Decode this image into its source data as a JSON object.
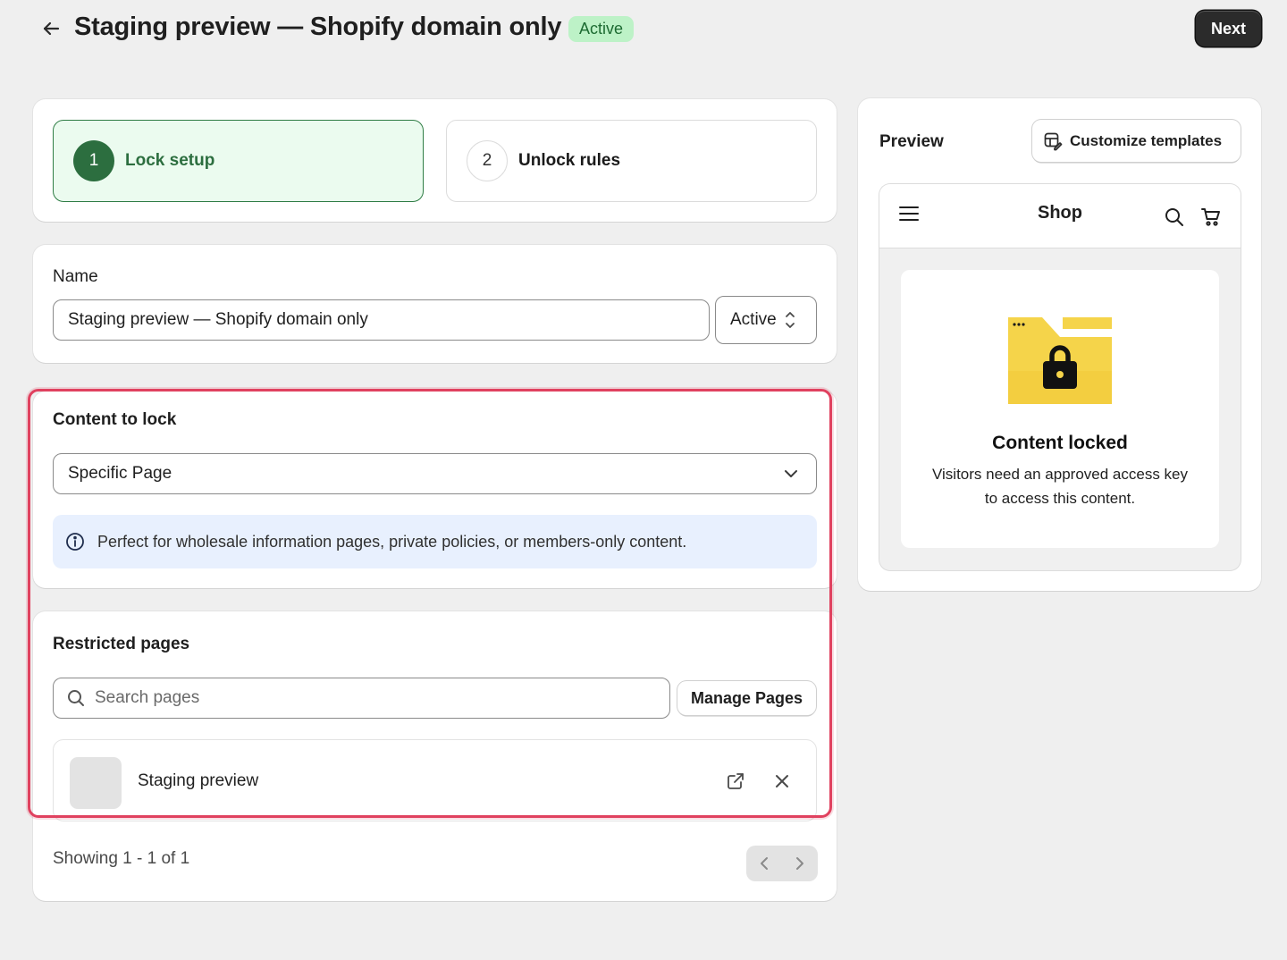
{
  "header": {
    "title": "Staging preview — Shopify domain only",
    "status_badge": "Active",
    "next_label": "Next"
  },
  "steps": [
    {
      "number": "1",
      "label": "Lock setup",
      "active": true
    },
    {
      "number": "2",
      "label": "Unlock rules",
      "active": false
    }
  ],
  "name_section": {
    "label": "Name",
    "value": "Staging preview — Shopify domain only",
    "status_select": "Active"
  },
  "content_to_lock": {
    "title": "Content to lock",
    "selected": "Specific Page",
    "info": "Perfect for wholesale information pages, private policies, or members-only content."
  },
  "restricted_pages": {
    "title": "Restricted pages",
    "search_placeholder": "Search pages",
    "manage_label": "Manage Pages",
    "pages": [
      {
        "title": "Staging preview"
      }
    ],
    "pagination_text": "Showing 1 - 1 of 1"
  },
  "preview": {
    "title": "Preview",
    "customize_label": "Customize templates",
    "shop_title": "Shop",
    "locked_title": "Content locked",
    "locked_message": "Visitors need an approved access key to access this content."
  },
  "colors": {
    "accent_green": "#2c6e3f",
    "badge_bg": "#bdf2c7",
    "highlight": "#e0415f",
    "info_bg": "#e8f0fe",
    "folder_yellow": "#f5d44a"
  }
}
